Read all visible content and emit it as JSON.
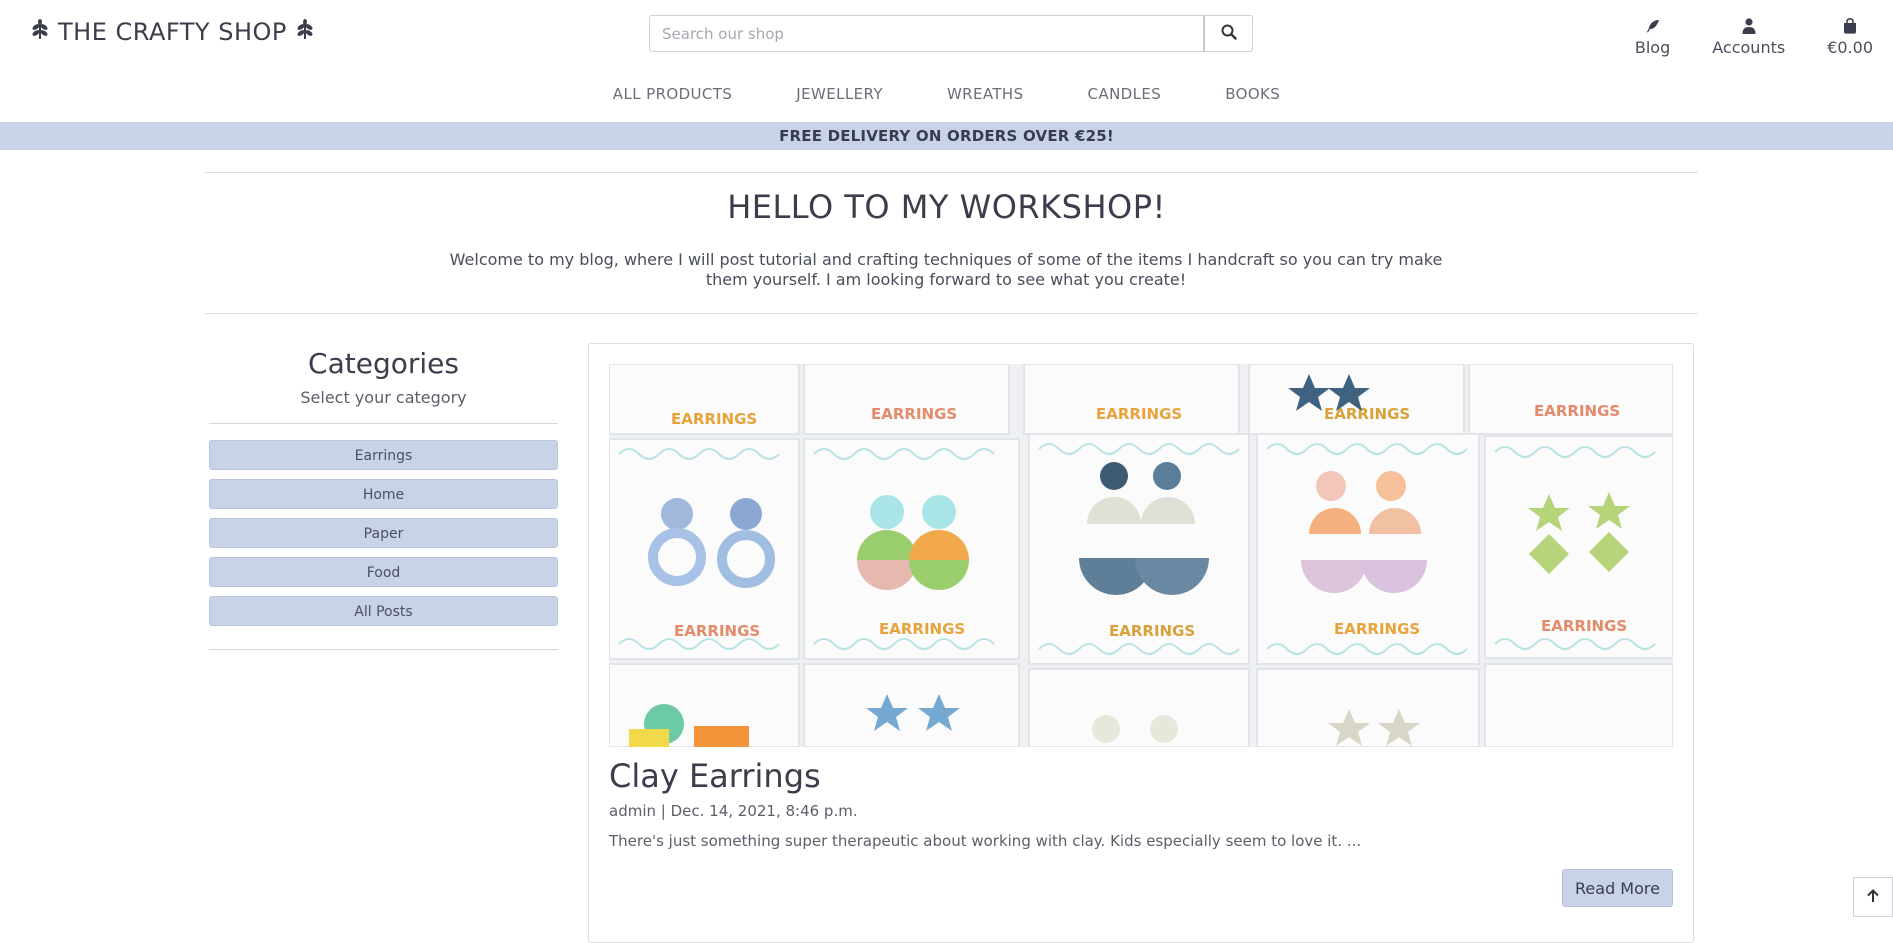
{
  "header": {
    "logo_text": "THE CRAFTY SHOP",
    "search_placeholder": "Search our shop",
    "links": [
      {
        "label": "Blog",
        "icon": "feather-icon"
      },
      {
        "label": "Accounts",
        "icon": "user-icon"
      },
      {
        "label": "€0.00",
        "icon": "shopping-bag-icon"
      }
    ]
  },
  "nav": [
    "ALL PRODUCTS",
    "JEWELLERY",
    "WREATHS",
    "CANDLES",
    "BOOKS"
  ],
  "banner": "FREE DELIVERY ON ORDERS OVER €25!",
  "hero": {
    "title": "HELLO TO MY WORKSHOP!",
    "text": "Welcome to my blog, where I will post tutorial and crafting techniques of some of the items I handcraft so you can try make them yourself. I am looking forward to see what you create!"
  },
  "sidebar": {
    "title": "Categories",
    "subtitle": "Select your category",
    "categories": [
      "Earrings",
      "Home",
      "Paper",
      "Food",
      "All Posts"
    ]
  },
  "post": {
    "title": "Clay Earrings",
    "meta": "admin | Dec. 14, 2021, 8:46 p.m.",
    "excerpt": "There's just something super therapeutic about working with clay. Kids especially seem to love it. ...",
    "read_more": "Read More",
    "image_card_text": "EARRINGS"
  },
  "colors": {
    "accent": "#c8d3e8",
    "text": "#3b3d4c"
  }
}
